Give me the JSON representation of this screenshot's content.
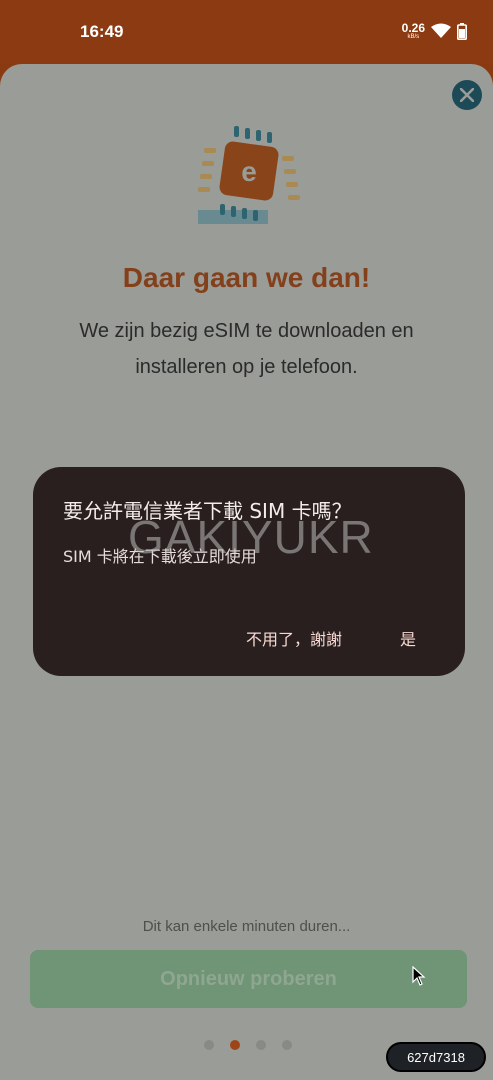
{
  "status_bar": {
    "time": "16:49",
    "speed": "0.26",
    "speed_unit": "kB/s"
  },
  "esim": {
    "icon_letter": "e",
    "headline": "Daar gaan we dan!",
    "subtitle": "We zijn bezig eSIM te downloaden en installeren op je telefoon.",
    "hint": "Dit kan enkele minuten duren...",
    "retry_label": "Opnieuw proberen",
    "page_count": 4,
    "active_page": 2
  },
  "dialog": {
    "title": "要允許電信業者下載 SIM 卡嗎？",
    "body": "SIM 卡將在下載後立即使用",
    "cancel_label": "不用了，謝謝",
    "confirm_label": "是"
  },
  "watermark": "GAKIYUKR",
  "session_id": "627d7318",
  "colors": {
    "status_bar": "#8b3a12",
    "sheet_scrim": "#9a9c98",
    "headline": "#84401b",
    "dialog_bg": "#2a1f1f",
    "retry_button": "#6f9476",
    "close_button": "#1d4a57"
  },
  "icons": [
    "wifi-icon",
    "battery-icon",
    "close-icon",
    "esim-chip-icon",
    "cursor-icon"
  ]
}
